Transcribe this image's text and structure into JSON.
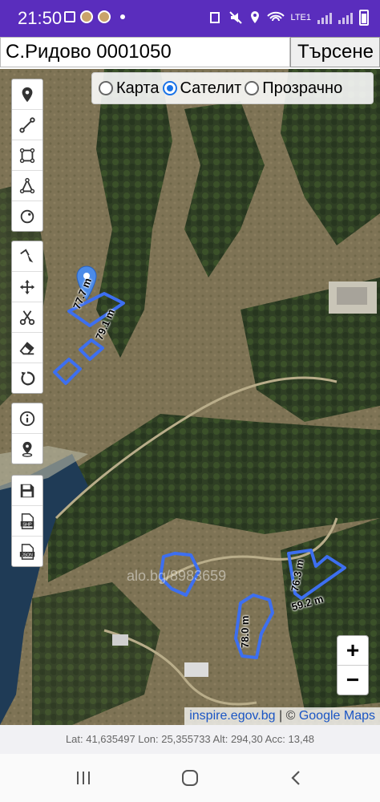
{
  "status_bar": {
    "time": "21:50",
    "network_label": "LTE1"
  },
  "search": {
    "value": "С.Ридово 0001050",
    "button_label": "Търсене"
  },
  "layers": {
    "options": [
      "Карта",
      "Сателит",
      "Прозрачно"
    ],
    "selected": "Сателит"
  },
  "tools": {
    "group1": [
      "marker-icon",
      "line-icon",
      "rectangle-icon",
      "polygon-icon",
      "circle-icon"
    ],
    "group2": [
      "edit-icon",
      "move-icon",
      "cut-icon",
      "eraser-icon",
      "rotate-icon"
    ],
    "group3": [
      "info-icon",
      "pin-locate-icon"
    ],
    "group4": [
      "save-icon",
      "shp-icon",
      "json-icon"
    ]
  },
  "measurements": {
    "m1": "77.7 m",
    "m2": "79.1 m",
    "m3": "76.3 m",
    "m4": "59.2 m",
    "m5": "78.0 m"
  },
  "zoom": {
    "in": "+",
    "out": "−"
  },
  "attribution": {
    "source": "inspire.egov.bg",
    "separator": " | © ",
    "maps": "Google Maps"
  },
  "watermark": "alo.bg/8983659",
  "coords_text": "Lat: 41,635497 Lon: 25,355733 Alt: 294,30 Acc: 13,48",
  "colors": {
    "status_bar": "#5a2dbd",
    "shape_stroke": "#3d6ff0",
    "radio_checked": "#1a73e8"
  }
}
